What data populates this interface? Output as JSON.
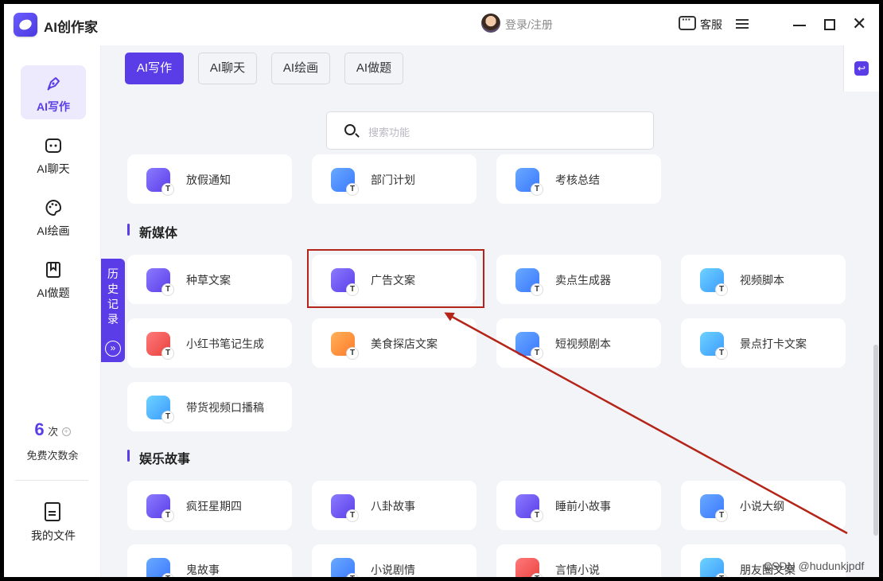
{
  "app": {
    "title": "AI创作家"
  },
  "header": {
    "login": "登录/注册",
    "service": "客服"
  },
  "sidebar": {
    "items": [
      {
        "label": "AI写作",
        "icon": "pen-icon",
        "active": true
      },
      {
        "label": "AI聊天",
        "icon": "chat-bot-icon",
        "active": false
      },
      {
        "label": "AI绘画",
        "icon": "palette-icon",
        "active": false
      },
      {
        "label": "AI做题",
        "icon": "bookmark-icon",
        "active": false
      }
    ],
    "free_count": "6",
    "free_unit": "次",
    "free_label": "免费次数余",
    "my_files": "我的文件"
  },
  "history": {
    "label": "历史记录"
  },
  "tabs": [
    {
      "label": "AI写作",
      "active": true
    },
    {
      "label": "AI聊天",
      "active": false
    },
    {
      "label": "AI绘画",
      "active": false
    },
    {
      "label": "AI做题",
      "active": false
    }
  ],
  "search": {
    "placeholder": "搜索功能"
  },
  "top_row": [
    {
      "label": "放假通知",
      "color": "#6b5cff"
    },
    {
      "label": "部门计划",
      "color": "#6aa8ff"
    },
    {
      "label": "考核总结",
      "color": "#3a78ff"
    }
  ],
  "sections": [
    {
      "title": "新媒体",
      "cards": [
        {
          "label": "种草文案",
          "color": "#6b5cff"
        },
        {
          "label": "广告文案",
          "color": "#6b5cff"
        },
        {
          "label": "卖点生成器",
          "color": "#3a78ff"
        },
        {
          "label": "视频脚本",
          "color": "#3a9bff"
        },
        {
          "label": "小红书笔记生成",
          "color": "#e8413d"
        },
        {
          "label": "美食探店文案",
          "color": "#ff7a2a"
        },
        {
          "label": "短视频剧本",
          "color": "#3a78ff"
        },
        {
          "label": "景点打卡文案",
          "color": "#3a9bff"
        },
        {
          "label": "带货视频口播稿",
          "color": "#3a9bff"
        }
      ]
    },
    {
      "title": "娱乐故事",
      "cards": [
        {
          "label": "疯狂星期四",
          "color": "#6b5cff"
        },
        {
          "label": "八卦故事",
          "color": "#6b5cff"
        },
        {
          "label": "睡前小故事",
          "color": "#6b5cff"
        },
        {
          "label": "小说大纲",
          "color": "#3a78ff"
        },
        {
          "label": "鬼故事",
          "color": "#3a78ff"
        },
        {
          "label": "小说剧情",
          "color": "#3a78ff"
        },
        {
          "label": "言情小说",
          "color": "#e8413d"
        },
        {
          "label": "朋友圈文案",
          "color": "#3a9bff"
        }
      ]
    }
  ],
  "watermark": "CSDN @hudunkjpdf",
  "colors": {
    "accent": "#5b3de8",
    "annotation": "#b42419"
  }
}
